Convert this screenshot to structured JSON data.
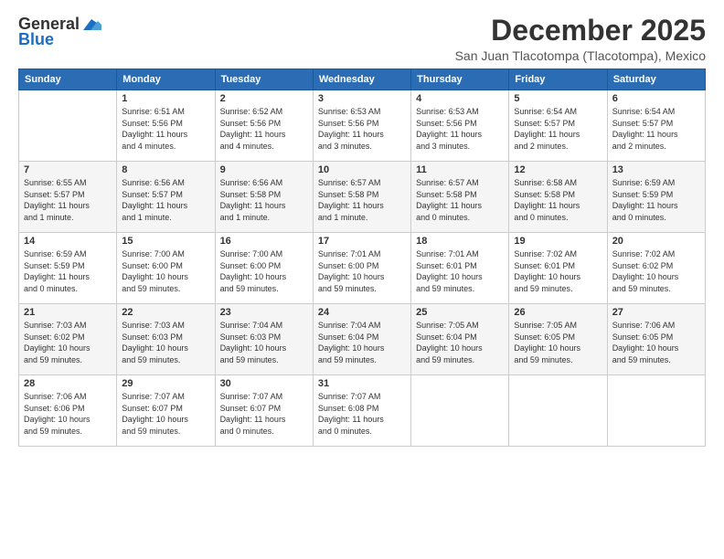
{
  "header": {
    "logo_general": "General",
    "logo_blue": "Blue",
    "month": "December 2025",
    "location": "San Juan Tlacotompa (Tlacotompa), Mexico"
  },
  "weekdays": [
    "Sunday",
    "Monday",
    "Tuesday",
    "Wednesday",
    "Thursday",
    "Friday",
    "Saturday"
  ],
  "weeks": [
    [
      {
        "day": "",
        "info": ""
      },
      {
        "day": "1",
        "info": "Sunrise: 6:51 AM\nSunset: 5:56 PM\nDaylight: 11 hours\nand 4 minutes."
      },
      {
        "day": "2",
        "info": "Sunrise: 6:52 AM\nSunset: 5:56 PM\nDaylight: 11 hours\nand 4 minutes."
      },
      {
        "day": "3",
        "info": "Sunrise: 6:53 AM\nSunset: 5:56 PM\nDaylight: 11 hours\nand 3 minutes."
      },
      {
        "day": "4",
        "info": "Sunrise: 6:53 AM\nSunset: 5:56 PM\nDaylight: 11 hours\nand 3 minutes."
      },
      {
        "day": "5",
        "info": "Sunrise: 6:54 AM\nSunset: 5:57 PM\nDaylight: 11 hours\nand 2 minutes."
      },
      {
        "day": "6",
        "info": "Sunrise: 6:54 AM\nSunset: 5:57 PM\nDaylight: 11 hours\nand 2 minutes."
      }
    ],
    [
      {
        "day": "7",
        "info": "Sunrise: 6:55 AM\nSunset: 5:57 PM\nDaylight: 11 hours\nand 1 minute."
      },
      {
        "day": "8",
        "info": "Sunrise: 6:56 AM\nSunset: 5:57 PM\nDaylight: 11 hours\nand 1 minute."
      },
      {
        "day": "9",
        "info": "Sunrise: 6:56 AM\nSunset: 5:58 PM\nDaylight: 11 hours\nand 1 minute."
      },
      {
        "day": "10",
        "info": "Sunrise: 6:57 AM\nSunset: 5:58 PM\nDaylight: 11 hours\nand 1 minute."
      },
      {
        "day": "11",
        "info": "Sunrise: 6:57 AM\nSunset: 5:58 PM\nDaylight: 11 hours\nand 0 minutes."
      },
      {
        "day": "12",
        "info": "Sunrise: 6:58 AM\nSunset: 5:58 PM\nDaylight: 11 hours\nand 0 minutes."
      },
      {
        "day": "13",
        "info": "Sunrise: 6:59 AM\nSunset: 5:59 PM\nDaylight: 11 hours\nand 0 minutes."
      }
    ],
    [
      {
        "day": "14",
        "info": "Sunrise: 6:59 AM\nSunset: 5:59 PM\nDaylight: 11 hours\nand 0 minutes."
      },
      {
        "day": "15",
        "info": "Sunrise: 7:00 AM\nSunset: 6:00 PM\nDaylight: 10 hours\nand 59 minutes."
      },
      {
        "day": "16",
        "info": "Sunrise: 7:00 AM\nSunset: 6:00 PM\nDaylight: 10 hours\nand 59 minutes."
      },
      {
        "day": "17",
        "info": "Sunrise: 7:01 AM\nSunset: 6:00 PM\nDaylight: 10 hours\nand 59 minutes."
      },
      {
        "day": "18",
        "info": "Sunrise: 7:01 AM\nSunset: 6:01 PM\nDaylight: 10 hours\nand 59 minutes."
      },
      {
        "day": "19",
        "info": "Sunrise: 7:02 AM\nSunset: 6:01 PM\nDaylight: 10 hours\nand 59 minutes."
      },
      {
        "day": "20",
        "info": "Sunrise: 7:02 AM\nSunset: 6:02 PM\nDaylight: 10 hours\nand 59 minutes."
      }
    ],
    [
      {
        "day": "21",
        "info": "Sunrise: 7:03 AM\nSunset: 6:02 PM\nDaylight: 10 hours\nand 59 minutes."
      },
      {
        "day": "22",
        "info": "Sunrise: 7:03 AM\nSunset: 6:03 PM\nDaylight: 10 hours\nand 59 minutes."
      },
      {
        "day": "23",
        "info": "Sunrise: 7:04 AM\nSunset: 6:03 PM\nDaylight: 10 hours\nand 59 minutes."
      },
      {
        "day": "24",
        "info": "Sunrise: 7:04 AM\nSunset: 6:04 PM\nDaylight: 10 hours\nand 59 minutes."
      },
      {
        "day": "25",
        "info": "Sunrise: 7:05 AM\nSunset: 6:04 PM\nDaylight: 10 hours\nand 59 minutes."
      },
      {
        "day": "26",
        "info": "Sunrise: 7:05 AM\nSunset: 6:05 PM\nDaylight: 10 hours\nand 59 minutes."
      },
      {
        "day": "27",
        "info": "Sunrise: 7:06 AM\nSunset: 6:05 PM\nDaylight: 10 hours\nand 59 minutes."
      }
    ],
    [
      {
        "day": "28",
        "info": "Sunrise: 7:06 AM\nSunset: 6:06 PM\nDaylight: 10 hours\nand 59 minutes."
      },
      {
        "day": "29",
        "info": "Sunrise: 7:07 AM\nSunset: 6:07 PM\nDaylight: 10 hours\nand 59 minutes."
      },
      {
        "day": "30",
        "info": "Sunrise: 7:07 AM\nSunset: 6:07 PM\nDaylight: 11 hours\nand 0 minutes."
      },
      {
        "day": "31",
        "info": "Sunrise: 7:07 AM\nSunset: 6:08 PM\nDaylight: 11 hours\nand 0 minutes."
      },
      {
        "day": "",
        "info": ""
      },
      {
        "day": "",
        "info": ""
      },
      {
        "day": "",
        "info": ""
      }
    ]
  ]
}
